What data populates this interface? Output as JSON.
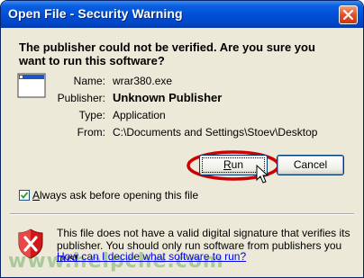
{
  "window": {
    "title": "Open File - Security Warning"
  },
  "message": "The publisher could not be verified.  Are you sure you want to run this software?",
  "details": {
    "name_label": "Name:",
    "name_value": "wrar380.exe",
    "publisher_label": "Publisher:",
    "publisher_value": "Unknown Publisher",
    "type_label": "Type:",
    "type_value": "Application",
    "from_label": "From:",
    "from_value": "C:\\Documents and Settings\\Stoev\\Desktop"
  },
  "buttons": {
    "run_mnemonic": "R",
    "run_rest": "un",
    "cancel": "Cancel"
  },
  "checkbox": {
    "checked": true,
    "mnemonic": "A",
    "label_rest": "lways ask before opening this file"
  },
  "warning": {
    "text": "This file does not have a valid digital signature that verifies its publisher.  You should only run software from publishers you trust.",
    "link": "How can I decide what software to run?"
  },
  "watermark": "www.helpche.com",
  "icons": {
    "close": "close-icon",
    "app": "application-icon",
    "shield": "security-shield-icon",
    "cursor": "mouse-cursor-icon"
  },
  "colors": {
    "titlebar": "#0050d8",
    "dialog_bg": "#ece9d8",
    "annotation": "#cc0000",
    "link": "#0000ee"
  }
}
